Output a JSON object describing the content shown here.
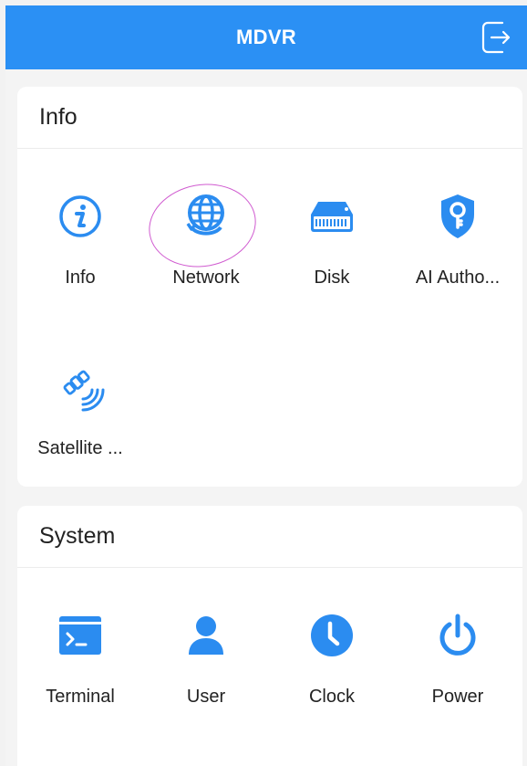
{
  "header": {
    "title": "MDVR",
    "logout_icon": "logout-icon"
  },
  "theme": {
    "header_bg": "#2b90f4",
    "icon_color": "#2b8cf0",
    "annotation_color": "#d05bd0"
  },
  "info": {
    "title": "Info",
    "items": [
      {
        "label": "Info",
        "icon": "info-icon"
      },
      {
        "label": "Network",
        "icon": "network-icon"
      },
      {
        "label": "Disk",
        "icon": "disk-icon"
      },
      {
        "label": "AI Autho...",
        "icon": "shield-key-icon"
      },
      {
        "label": "Satellite ...",
        "icon": "satellite-icon"
      }
    ]
  },
  "system": {
    "title": "System",
    "items": [
      {
        "label": "Terminal",
        "icon": "terminal-icon"
      },
      {
        "label": "User",
        "icon": "user-icon"
      },
      {
        "label": "Clock",
        "icon": "clock-icon"
      },
      {
        "label": "Power",
        "icon": "power-icon"
      }
    ]
  }
}
